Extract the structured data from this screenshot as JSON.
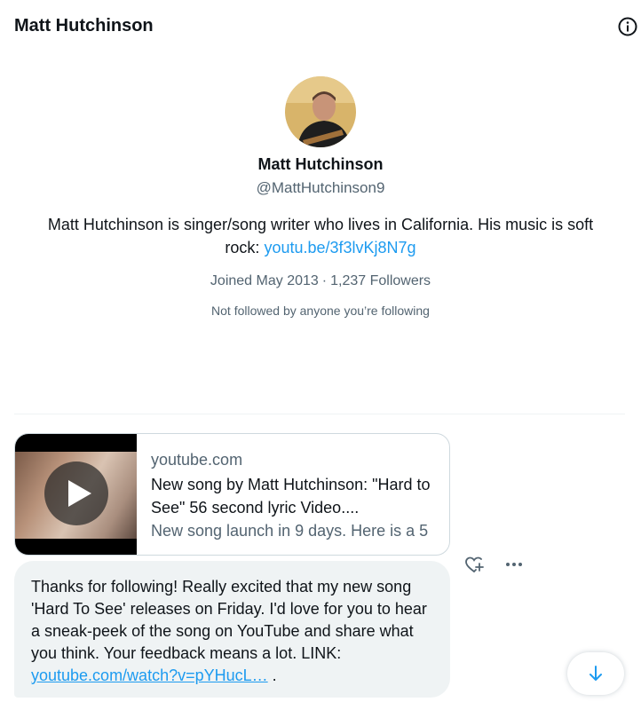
{
  "header": {
    "title": "Matt Hutchinson",
    "info_icon": "info-icon"
  },
  "profile": {
    "display_name": "Matt Hutchinson",
    "handle": "@MattHutchinson9",
    "bio_text": "Matt Hutchinson is singer/song writer who lives in California. His music is soft rock: ",
    "bio_link": "youtu.be/3f3lvKj8N7g",
    "joined": "Joined May 2013",
    "separator": "·",
    "followers": "1,237 Followers",
    "not_followed": "Not followed by anyone you’re following"
  },
  "link_card": {
    "domain": "youtube.com",
    "title": "New song by Matt Hutchinson: \"Hard to See\" 56 second lyric Video....",
    "description": "New song launch in 9 days. Here is a 5",
    "thumbnail_icon": "play-icon"
  },
  "message": {
    "text": "Thanks for following! Really excited that my new song 'Hard To See' releases on Friday. I'd love for you to hear a sneak-peek of the song on YouTube and share what you think. Your feedback means a lot. LINK: ",
    "link": "youtube.com/watch?v=pYHucL…",
    "trailing": " ."
  },
  "actions": {
    "react_icon": "add-reaction-icon",
    "more_icon": "more-icon",
    "scroll_icon": "arrow-down-icon"
  },
  "colors": {
    "accent": "#1d9bf0",
    "text_primary": "#0f1419",
    "text_secondary": "#536471",
    "bubble_bg": "#eff3f4"
  }
}
